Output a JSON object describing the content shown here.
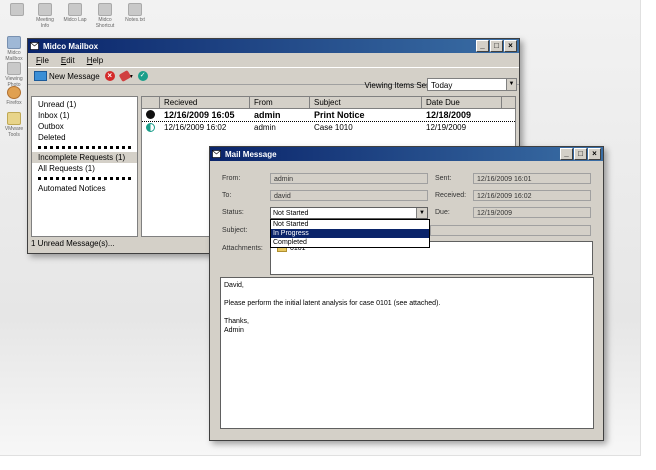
{
  "desktop": {
    "icons": [
      {
        "label": "",
        "style": "gray"
      },
      {
        "label": "Meeting Info",
        "style": "gray"
      },
      {
        "label": "Midco Lap",
        "style": "gray"
      },
      {
        "label": "Midco Shortcut",
        "style": "gray"
      },
      {
        "label": "Notes.txt",
        "style": "gray"
      },
      {
        "label": "Midco Mailbox",
        "style": "blue"
      },
      {
        "label": "Viewing Photo",
        "style": "gray"
      },
      {
        "label": "Firefox",
        "style": "orange"
      },
      {
        "label": "VMware Tools",
        "style": "yellow"
      }
    ]
  },
  "midco": {
    "title": "Midco Mailbox",
    "menu": [
      "File",
      "Edit",
      "Help"
    ],
    "toolbar": {
      "new_message": "New Message"
    },
    "viewing_label": "Viewing Items Sent:",
    "viewing_value": "Today",
    "folders": [
      {
        "label": "Unread (1)",
        "selected": false
      },
      {
        "label": "Inbox (1)",
        "selected": false
      },
      {
        "label": "Outbox",
        "selected": false
      },
      {
        "label": "Deleted",
        "selected": false
      },
      {
        "label": "Incomplete Requests (1)",
        "selected": true
      },
      {
        "label": "All Requests (1)",
        "selected": false
      },
      {
        "label": "Automated Notices",
        "selected": false
      }
    ],
    "columns": [
      "Recieved",
      "From",
      "Subject",
      "Date Due"
    ],
    "messages": [
      {
        "received": "12/16/2009 16:05",
        "from": "admin",
        "subject": "Print Notice",
        "due": "12/18/2009",
        "unread": true,
        "icon": "black"
      },
      {
        "received": "12/16/2009 16:02",
        "from": "admin",
        "subject": "Case 1010",
        "due": "12/19/2009",
        "unread": false,
        "icon": "half"
      }
    ],
    "status": "1 Unread Message(s)..."
  },
  "mail": {
    "title": "Mail Message",
    "from_label": "From:",
    "from": "admin",
    "to_label": "To:",
    "to": "david",
    "status_label": "Status:",
    "status_value": "Not Started",
    "subject_label": "Subject:",
    "attachments_label": "Attachments:",
    "sent_label": "Sent:",
    "sent": "12/16/2009 16:01",
    "received_label": "Received:",
    "received": "12/16/2009 16:02",
    "due_label": "Due:",
    "due": "12/19/2009",
    "status_options": [
      "Not Started",
      "In Progress",
      "Completed"
    ],
    "status_highlight": "In Progress",
    "attachment": "0101",
    "body": "David,\n\nPlease perform the initial latent analysis for case 0101 (see attached).\n\nThanks,\nAdmin"
  }
}
